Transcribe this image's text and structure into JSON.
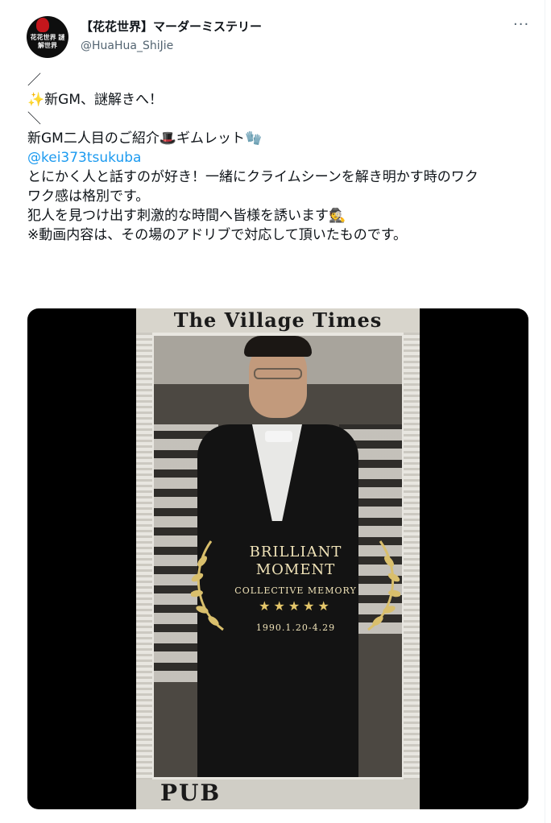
{
  "tweet": {
    "avatar_text": "花花世界 謎解世界",
    "display_name": "【花花世界】マーダーミステリー",
    "handle": "@HuaHua_ShiJie",
    "more_label": "···",
    "lines": [
      "／",
      "✨新GM、謎解きへ！",
      "＼",
      "",
      "新GM二人目のご紹介🎩ギムレット🧤"
    ],
    "mention": "@kei373tsukuba",
    "lines2": [
      "",
      "とにかく人と話すのが好き！一緒にクライムシーンを解き明かす時のワク",
      "ワク感は格別です。",
      "犯人を見つけ出す刺激的な時間へ皆様を誘います🕵",
      "",
      "※動画内容は、その場のアドリブで対応して頂いたものです。"
    ]
  },
  "media": {
    "newspaper_header": "The Village Times",
    "newspaper_footer": "PUB",
    "overlay_title_1": "BRILLIANT",
    "overlay_title_2": "MOMENT",
    "overlay_sub": "COLLECTIVE MEMORY",
    "overlay_stars": "★★★★★",
    "overlay_date": "1990.1.20-4.29"
  }
}
